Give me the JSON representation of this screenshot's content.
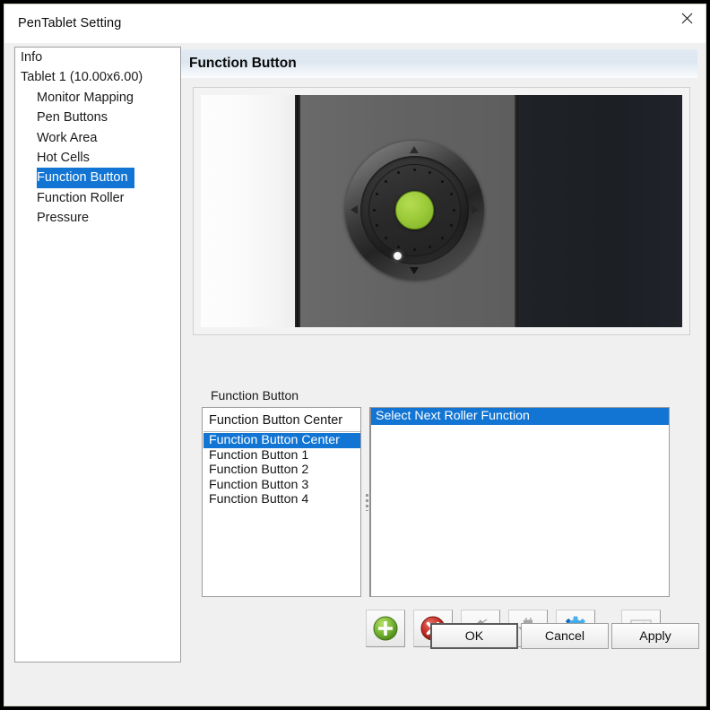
{
  "window": {
    "title": "PenTablet Setting",
    "close_icon": "close-icon"
  },
  "sidebar": {
    "items": [
      {
        "label": "Info",
        "level": 0,
        "selected": false
      },
      {
        "label": "Tablet  1 (10.00x6.00)",
        "level": 0,
        "selected": false
      },
      {
        "label": "Monitor Mapping",
        "level": 1,
        "selected": false
      },
      {
        "label": "Pen Buttons",
        "level": 1,
        "selected": false
      },
      {
        "label": "Work Area",
        "level": 1,
        "selected": false
      },
      {
        "label": "Hot Cells",
        "level": 1,
        "selected": false
      },
      {
        "label": "Function Button",
        "level": 1,
        "selected": true
      },
      {
        "label": "Function Roller",
        "level": 1,
        "selected": false
      },
      {
        "label": "Pressure",
        "level": 1,
        "selected": false
      }
    ]
  },
  "content": {
    "section_title": "Function Button",
    "preview": {
      "image_name": "tablet-device-preview",
      "dial_center_color": "#9ccb3b",
      "led_color": "#ffffff",
      "arrows": [
        "up",
        "right",
        "down",
        "left"
      ]
    },
    "group_label": "Function Button",
    "name_field": {
      "value": "Function Button Center",
      "placeholder": ""
    },
    "button_list": [
      {
        "label": "Function Button Center",
        "selected": true
      },
      {
        "label": "Function Button 1",
        "selected": false
      },
      {
        "label": "Function Button 2",
        "selected": false
      },
      {
        "label": "Function Button 3",
        "selected": false
      },
      {
        "label": "Function Button 4",
        "selected": false
      }
    ],
    "action_list": [
      {
        "label": "Select Next Roller Function",
        "selected": true
      }
    ],
    "toolbar": [
      {
        "name": "add-button",
        "icon": "plus-circle-icon",
        "color": "#6aaa2e",
        "enabled": true
      },
      {
        "name": "delete-button",
        "icon": "x-circle-icon",
        "color": "#c42a24",
        "enabled": true
      },
      {
        "name": "move-up-button",
        "icon": "arrow-up-icon",
        "color": "#9a9a9a",
        "enabled": false
      },
      {
        "name": "move-down-button",
        "icon": "arrow-down-icon",
        "color": "#9a9a9a",
        "enabled": false
      },
      {
        "name": "settings-button",
        "icon": "gear-icon",
        "color": "#1e8fe0",
        "enabled": true
      },
      {
        "name": "reset-button",
        "icon": "restore-image-icon",
        "color": "#c8c8c8",
        "enabled": false
      }
    ]
  },
  "dialog_buttons": {
    "ok": "OK",
    "cancel": "Cancel",
    "apply": "Apply"
  },
  "colors": {
    "selection_blue": "#1275d4",
    "header_gradient_start": "#e2eaf2",
    "window_background": "#f0f0f0"
  }
}
